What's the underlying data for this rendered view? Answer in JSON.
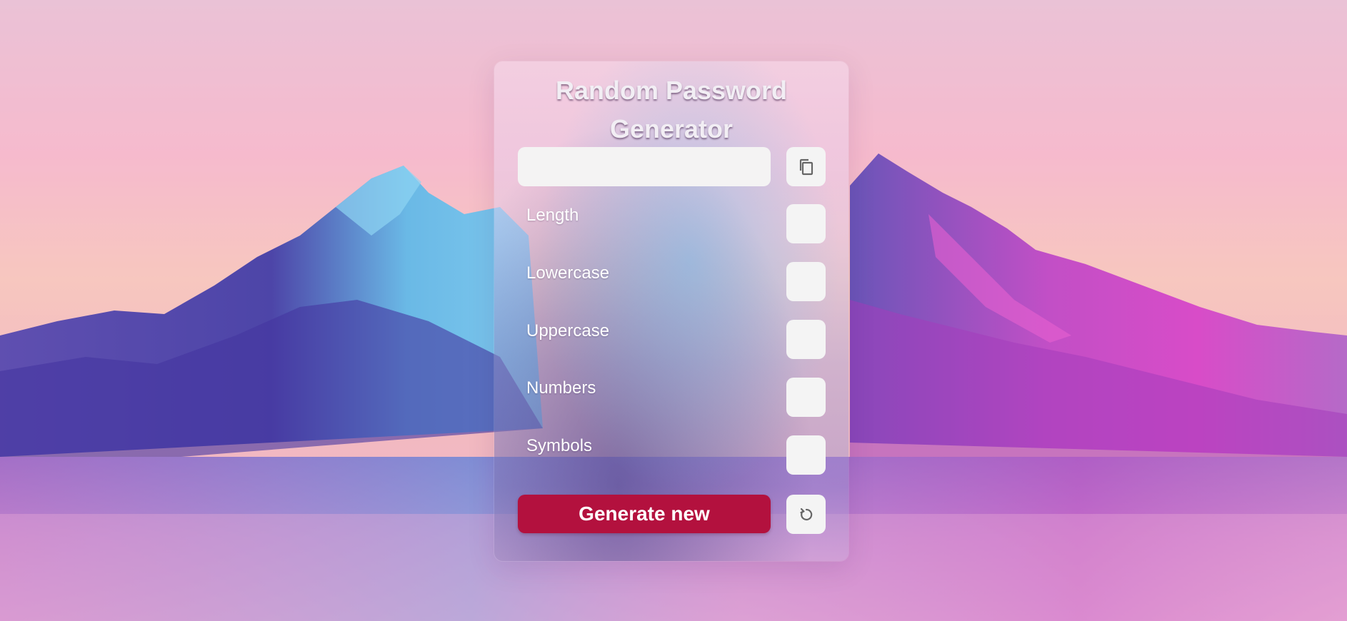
{
  "app": {
    "title": "Random Password Generator"
  },
  "password": {
    "value": "",
    "placeholder": "",
    "copy_icon": "copy-icon"
  },
  "options": [
    {
      "id": "length",
      "label": "Length",
      "value": ""
    },
    {
      "id": "lowercase",
      "label": "Lowercase",
      "checked": false
    },
    {
      "id": "uppercase",
      "label": "Uppercase",
      "checked": false
    },
    {
      "id": "numbers",
      "label": "Numbers",
      "checked": false
    },
    {
      "id": "symbols",
      "label": "Symbols",
      "checked": false
    }
  ],
  "actions": {
    "generate_label": "Generate new",
    "reset_icon": "refresh-icon"
  },
  "colors": {
    "accent": "#b3113e",
    "control_bg": "#f4f4f4"
  }
}
